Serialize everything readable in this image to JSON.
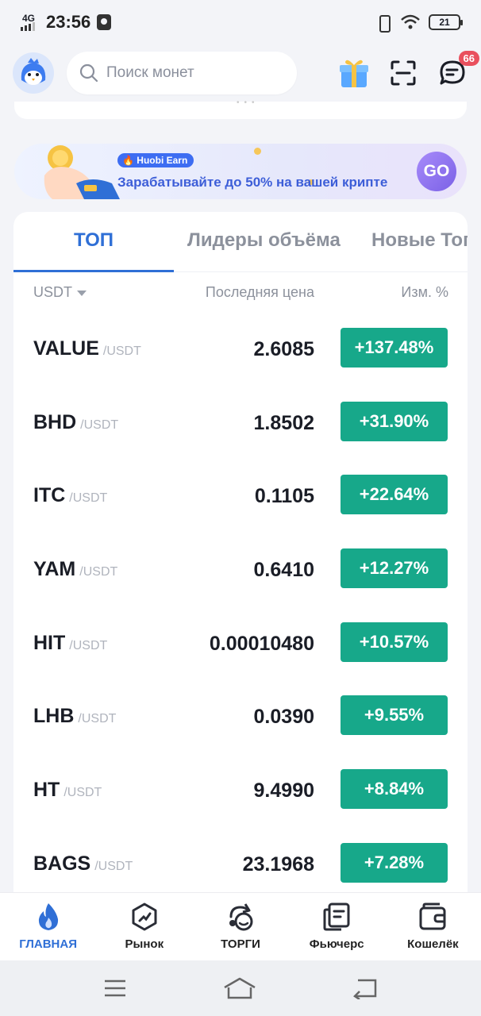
{
  "status_bar": {
    "network": "4G",
    "time": "23:56",
    "battery": "21"
  },
  "header": {
    "search_placeholder": "Поиск монет",
    "notification_count": "66"
  },
  "banner": {
    "tag": "Huobi Earn",
    "text": "Зарабатывайте до 50% на вашей крипте",
    "button": "GO"
  },
  "market": {
    "tabs": [
      "ТОП",
      "Лидеры объёма",
      "Новые Топ"
    ],
    "active_tab": 0,
    "columns": {
      "quote": "USDT",
      "price": "Последняя цена",
      "change": "Изм. %"
    },
    "rows": [
      {
        "symbol": "VALUE",
        "quote": "/USDT",
        "price": "2.6085",
        "change": "+137.48%"
      },
      {
        "symbol": "BHD",
        "quote": "/USDT",
        "price": "1.8502",
        "change": "+31.90%"
      },
      {
        "symbol": "ITC",
        "quote": "/USDT",
        "price": "0.1105",
        "change": "+22.64%"
      },
      {
        "symbol": "YAM",
        "quote": "/USDT",
        "price": "0.6410",
        "change": "+12.27%"
      },
      {
        "symbol": "HIT",
        "quote": "/USDT",
        "price": "0.00010480",
        "change": "+10.57%"
      },
      {
        "symbol": "LHB",
        "quote": "/USDT",
        "price": "0.0390",
        "change": "+9.55%"
      },
      {
        "symbol": "HT",
        "quote": "/USDT",
        "price": "9.4990",
        "change": "+8.84%"
      },
      {
        "symbol": "BAGS",
        "quote": "/USDT",
        "price": "23.1968",
        "change": "+7.28%"
      }
    ]
  },
  "bottom_nav": {
    "items": [
      {
        "label": "ГЛАВНАЯ",
        "icon": "flame-icon",
        "active": true
      },
      {
        "label": "Рынок",
        "icon": "market-icon",
        "active": false
      },
      {
        "label": "ТОРГИ",
        "icon": "trade-icon",
        "active": false
      },
      {
        "label": "Фьючерс",
        "icon": "futures-icon",
        "active": false
      },
      {
        "label": "Кошелёк",
        "icon": "wallet-icon",
        "active": false
      }
    ]
  },
  "colors": {
    "accent": "#2f6fd6",
    "positive": "#17a88a",
    "badge": "#e9505e"
  }
}
